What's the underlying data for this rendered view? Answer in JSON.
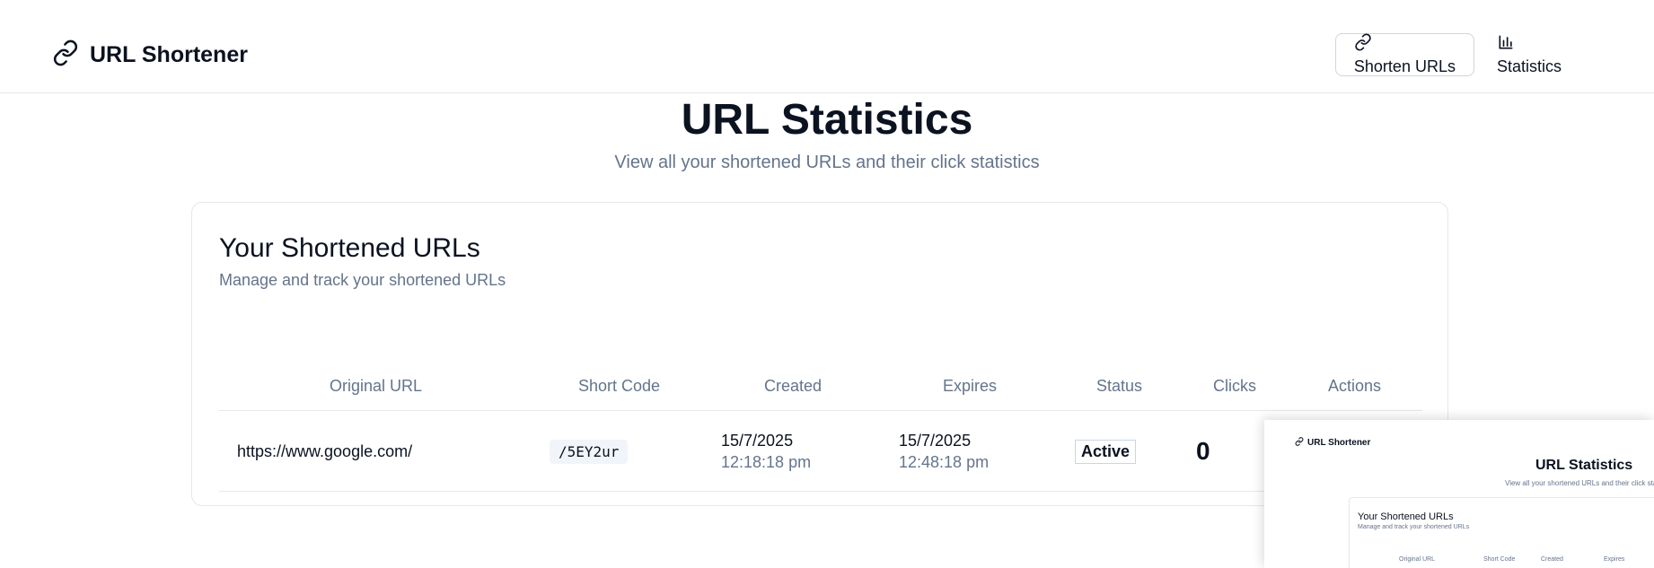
{
  "header": {
    "brand_icon": "link-icon",
    "brand_title": "URL Shortener",
    "nav": [
      {
        "label": "Shorten URLs",
        "icon": "link-icon",
        "active": true
      },
      {
        "label": "Statistics",
        "icon": "bar-chart-icon",
        "active": false
      }
    ]
  },
  "page": {
    "title": "URL Statistics",
    "subtitle": "View all your shortened URLs and their click statistics"
  },
  "card": {
    "title": "Your Shortened URLs",
    "description": "Manage and track your shortened URLs",
    "columns": [
      "Original URL",
      "Short Code",
      "Created",
      "Expires",
      "Status",
      "Clicks",
      "Actions"
    ],
    "rows": [
      {
        "original_url": "https://www.google.com/",
        "short_code": "/5EY2ur",
        "created_date": "15/7/2025",
        "created_time": "12:18:18 pm",
        "expires_date": "15/7/2025",
        "expires_time": "12:48:18 pm",
        "status": "Active",
        "clicks": "0"
      }
    ]
  },
  "thumbnail": {
    "brand_title": "URL Shortener",
    "title": "URL Statistics",
    "subtitle": "View all your shortened URLs and their click statistics",
    "card_title": "Your Shortened URLs",
    "card_description": "Manage and track your shortened URLs",
    "columns": [
      "Original URL",
      "Short Code",
      "Created",
      "Expires"
    ]
  },
  "colors": {
    "text": "#0b1220",
    "muted": "#64748b",
    "border": "#e5e7eb"
  }
}
